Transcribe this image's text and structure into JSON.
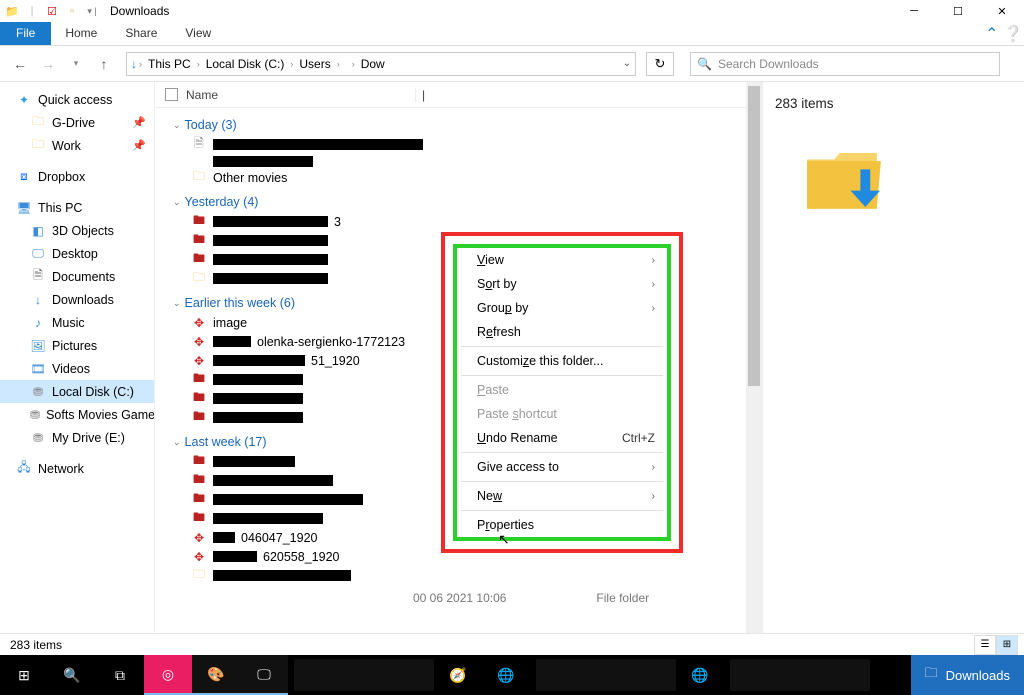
{
  "window": {
    "title": "Downloads"
  },
  "ribbon": {
    "file": "File",
    "tabs": [
      "Home",
      "Share",
      "View"
    ]
  },
  "breadcrumb": {
    "segs": [
      "This PC",
      "Local Disk (C:)",
      "Users",
      "",
      "Dow"
    ]
  },
  "search": {
    "placeholder": "Search Downloads"
  },
  "sidebar": {
    "quick_access": "Quick access",
    "gdrive": "G-Drive",
    "work": "Work",
    "dropbox": "Dropbox",
    "thispc": "This PC",
    "objects3d": "3D Objects",
    "desktop": "Desktop",
    "documents": "Documents",
    "downloads": "Downloads",
    "music": "Music",
    "pictures": "Pictures",
    "videos": "Videos",
    "localdisk": "Local Disk (C:)",
    "softs": "Softs Movies Games",
    "mydrive": "My Drive (E:)",
    "network": "Network"
  },
  "columns": {
    "name": "Name"
  },
  "groups": {
    "today": "Today (3)",
    "yesterday": "Yesterday (4)",
    "earlier": "Earlier this week (6)",
    "lastweek": "Last week (17)"
  },
  "files": {
    "other_movies": "Other movies",
    "image": "image",
    "pexels": "olenka-sergienko-1772123",
    "wkpl": "51_1920",
    "f1046": "046047_1920",
    "f4620": "620558_1920",
    "fake3": "3"
  },
  "list_meta": {
    "date_partial": "00 06 2021 10:06",
    "type_partial": "File folder"
  },
  "details": {
    "count": "283 items"
  },
  "status": {
    "count": "283 items"
  },
  "context_menu": {
    "view": "View",
    "sort": "Sort by",
    "group": "Group by",
    "refresh": "Refresh",
    "customize": "Customize this folder...",
    "paste": "Paste",
    "paste_shortcut": "Paste shortcut",
    "undo_rename": "Undo Rename",
    "undo_shortcut": "Ctrl+Z",
    "give_access": "Give access to",
    "new": "New",
    "properties": "Properties"
  },
  "taskbar": {
    "downloads": "Downloads"
  }
}
